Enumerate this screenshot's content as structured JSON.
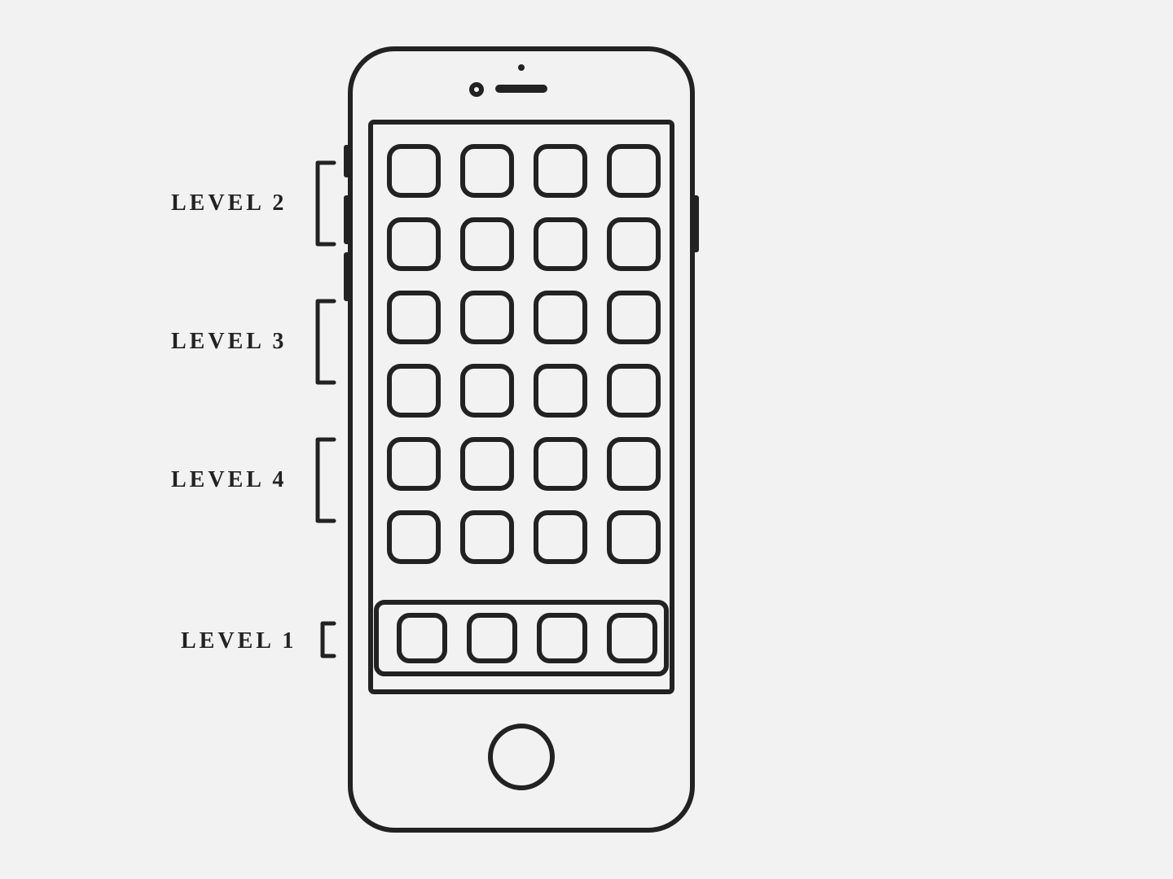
{
  "labels": {
    "level2": "LEVEL  2",
    "level3": "LEVEL  3",
    "level4": "LEVEL  4",
    "level1": "LEVEL  1"
  },
  "diagram": {
    "type": "phone-home-screen-levels",
    "grid": {
      "columns": 4,
      "rows": 6
    },
    "dock_icons": 4,
    "level_groups": {
      "level2": "rows 1-2 of icon grid",
      "level3": "rows 3-4 of icon grid",
      "level4": "rows 5-6 of icon grid",
      "level1": "dock row"
    }
  }
}
